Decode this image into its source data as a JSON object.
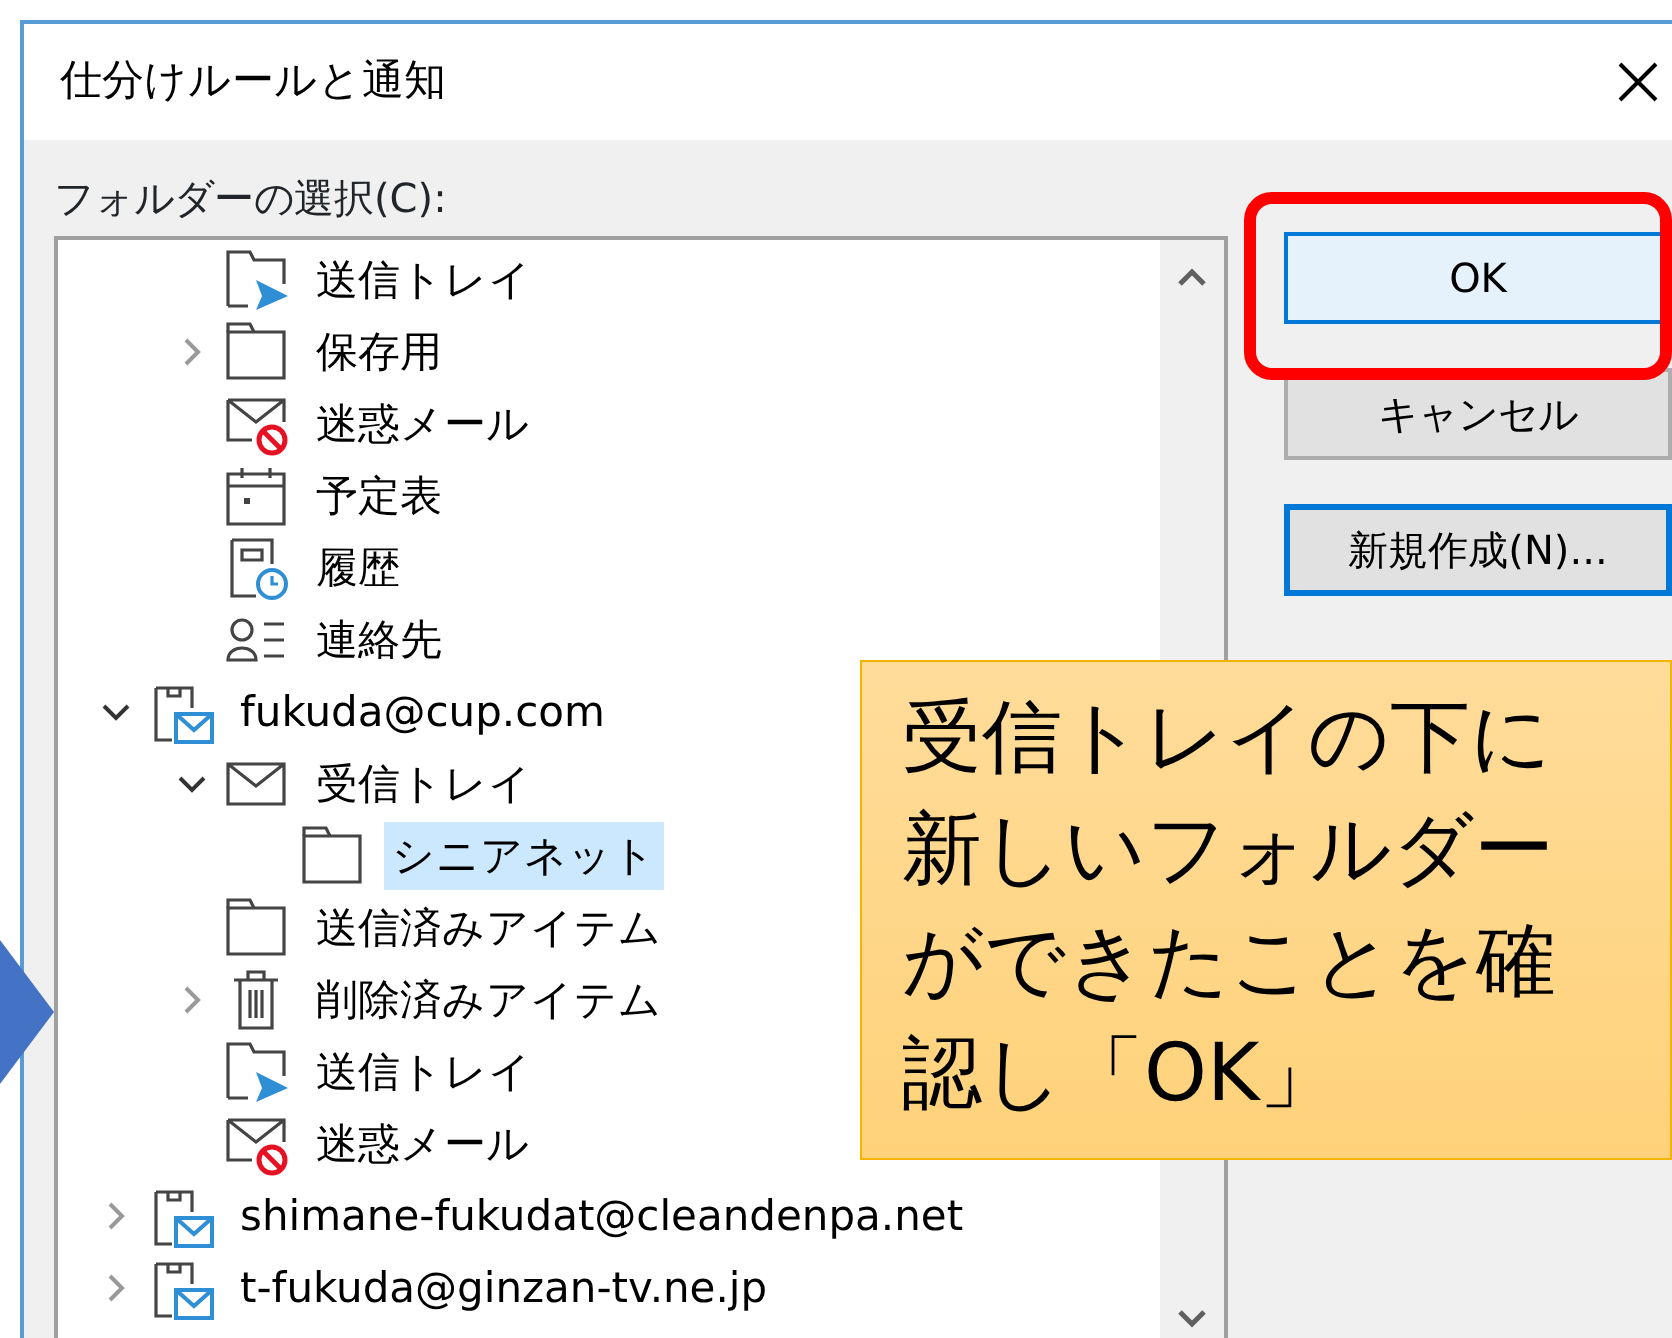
{
  "window": {
    "title": "仕分けルールと通知"
  },
  "folder_label": "フォルダーの選択(C):",
  "tree": {
    "items": [
      {
        "children": [
          {
            "label": "送信トレイ",
            "kind": "outbox",
            "selected": false
          },
          {
            "label": "保存用",
            "kind": "folder",
            "expanded": false,
            "selected": false
          },
          {
            "label": "迷惑メール",
            "kind": "junk",
            "selected": false
          },
          {
            "label": "予定表",
            "kind": "calendar",
            "selected": false
          },
          {
            "label": "履歴",
            "kind": "journal",
            "selected": false
          },
          {
            "label": "連絡先",
            "kind": "contacts",
            "selected": false
          }
        ]
      },
      {
        "label": "fukuda@cup.com",
        "kind": "account",
        "expanded": true,
        "selected": false,
        "children": [
          {
            "label": "受信トレイ",
            "kind": "inbox",
            "expanded": true,
            "selected": false,
            "children": [
              {
                "label": "シニアネット",
                "kind": "folder",
                "selected": true
              }
            ]
          },
          {
            "label": "送信済みアイテム",
            "kind": "folder",
            "selected": false
          },
          {
            "label": "削除済みアイテム",
            "kind": "trash",
            "expanded": false,
            "selected": false
          },
          {
            "label": "送信トレイ",
            "kind": "outbox",
            "selected": false
          },
          {
            "label": "迷惑メール",
            "kind": "junk",
            "selected": false
          }
        ]
      },
      {
        "label": "shimane-fukudat@cleandenpa.net",
        "kind": "account",
        "expanded": false,
        "selected": false
      },
      {
        "label": "t-fukuda@ginzan-tv.ne.jp",
        "kind": "account",
        "expanded": false,
        "selected": false
      }
    ]
  },
  "buttons": [
    {
      "label": "OK",
      "kind": "default",
      "highlighted": true
    },
    {
      "label": "キャンセル",
      "kind": "normal",
      "highlighted": false
    },
    {
      "label": "新規作成(N)...",
      "kind": "focused",
      "highlighted": false
    }
  ],
  "callout": {
    "lines": [
      "受信トレイの下に",
      "新しいフォルダー",
      "ができたことを確",
      "認し「OK」"
    ]
  }
}
